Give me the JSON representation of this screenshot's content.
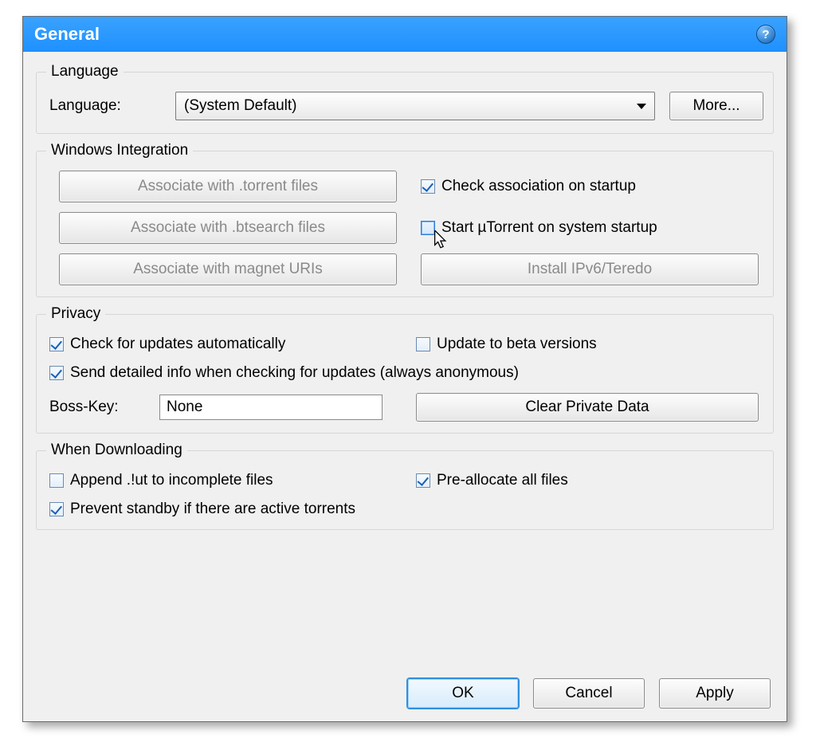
{
  "title": "General",
  "language": {
    "legend": "Language",
    "label": "Language:",
    "selected": "(System Default)",
    "more": "More..."
  },
  "winint": {
    "legend": "Windows Integration",
    "assoc_torrent": "Associate with .torrent files",
    "assoc_btsearch": "Associate with .btsearch files",
    "assoc_magnet": "Associate with magnet URIs",
    "check_assoc": "Check association on startup",
    "start_on_boot": "Start µTorrent on system startup",
    "install_ipv6": "Install IPv6/Teredo"
  },
  "privacy": {
    "legend": "Privacy",
    "check_updates": "Check for updates automatically",
    "update_beta": "Update to beta versions",
    "send_detailed": "Send detailed info when checking for updates (always anonymous)",
    "bosskey_label": "Boss-Key:",
    "bosskey_value": "None",
    "clear_private": "Clear Private Data"
  },
  "downloading": {
    "legend": "When Downloading",
    "append_ut": "Append .!ut to incomplete files",
    "prealloc": "Pre-allocate all files",
    "prevent_standby": "Prevent standby if there are active torrents"
  },
  "footer": {
    "ok": "OK",
    "cancel": "Cancel",
    "apply": "Apply"
  },
  "checked": {
    "check_assoc": true,
    "start_on_boot": false,
    "check_updates": true,
    "update_beta": false,
    "send_detailed": true,
    "append_ut": false,
    "prealloc": true,
    "prevent_standby": true
  }
}
